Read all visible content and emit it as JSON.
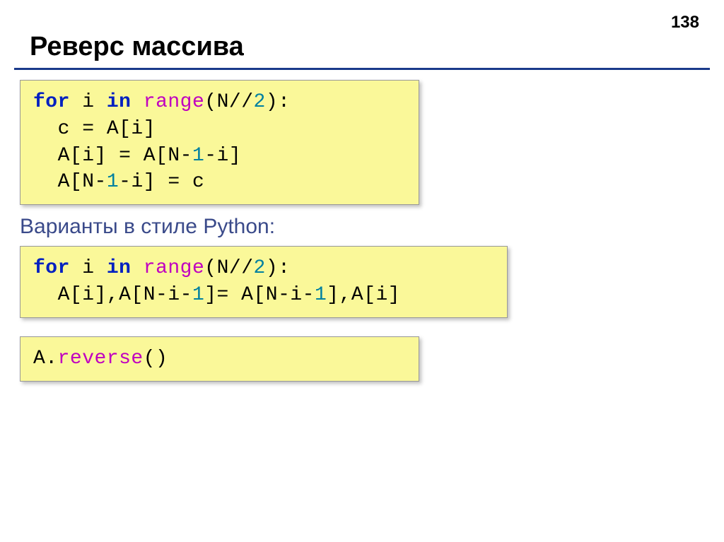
{
  "page_number": "138",
  "title": "Реверс массива",
  "subheading": "Варианты в стиле Python:",
  "code1": {
    "l1_kw1": "for",
    "l1_var": " i ",
    "l1_kw2": "in",
    "l1_sp": " ",
    "l1_func": "range",
    "l1_open": "(N//",
    "l1_num": "2",
    "l1_close": "):",
    "l2": "  c = A[i]",
    "l3_a": "  A[i] = A[N-",
    "l3_num": "1",
    "l3_b": "-i]",
    "l4_a": "  A[N-",
    "l4_num": "1",
    "l4_b": "-i] = c"
  },
  "code2": {
    "l1_kw1": "for",
    "l1_var": " i ",
    "l1_kw2": "in",
    "l1_sp": " ",
    "l1_func": "range",
    "l1_open": "(N//",
    "l1_num": "2",
    "l1_close": "):",
    "l2_a": "  A[i],A[N-i-",
    "l2_n1": "1",
    "l2_b": "]= A[N-i-",
    "l2_n2": "1",
    "l2_c": "],A[i]"
  },
  "code3": {
    "a": "A.",
    "method": "reverse",
    "b": "()"
  }
}
